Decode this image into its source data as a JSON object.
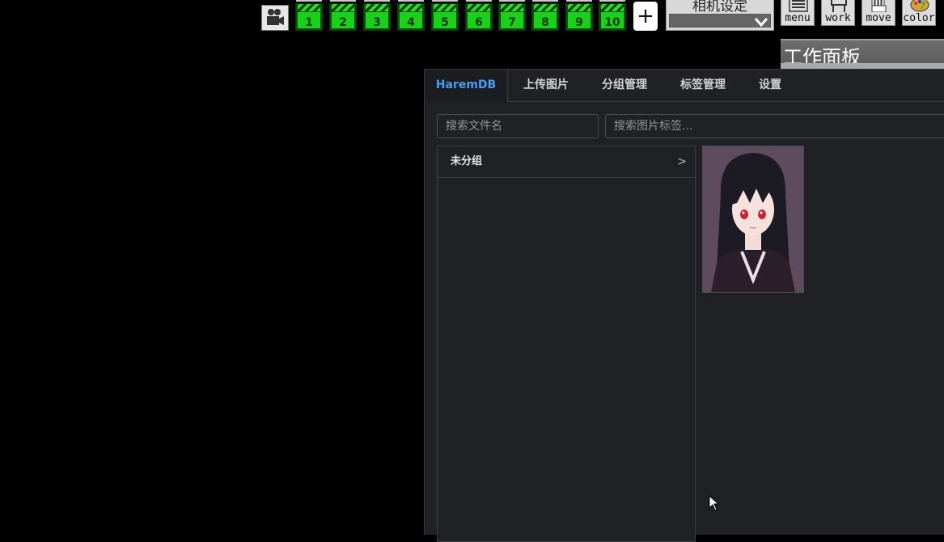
{
  "toolbar": {
    "scene_numbers": [
      "1",
      "2",
      "3",
      "4",
      "5",
      "6",
      "7",
      "8",
      "9",
      "10"
    ],
    "add_label": "+",
    "camera_settings_label": "相机设定",
    "tools": [
      {
        "label": "menu",
        "icon": "menu-list-icon"
      },
      {
        "label": "work",
        "icon": "work-chair-icon"
      },
      {
        "label": "move",
        "icon": "hand-icon"
      },
      {
        "label": "color",
        "icon": "palette-icon"
      }
    ]
  },
  "work_panel": {
    "title": "工作面板"
  },
  "harem": {
    "tabs": [
      {
        "label": "HaremDB",
        "active": true
      },
      {
        "label": "上传图片",
        "active": false
      },
      {
        "label": "分组管理",
        "active": false
      },
      {
        "label": "标签管理",
        "active": false
      },
      {
        "label": "设置",
        "active": false
      }
    ],
    "search_filename_placeholder": "搜索文件名",
    "search_tags_placeholder": "搜索图片标签...",
    "groups": [
      {
        "label": "未分组",
        "arrow": ">"
      }
    ]
  },
  "colors": {
    "accent": "#4a9cf0",
    "panel_bg": "#1f2124",
    "clap_green": "#19d119"
  }
}
